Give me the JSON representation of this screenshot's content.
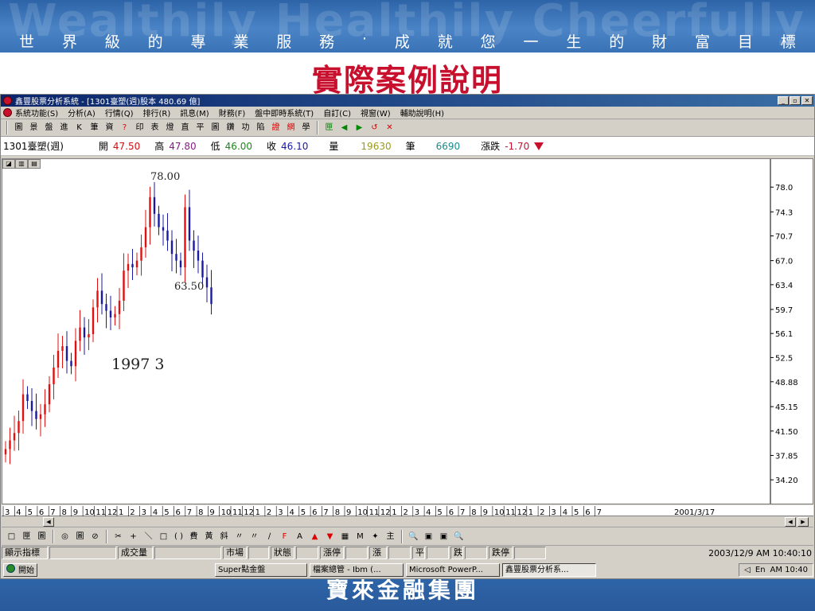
{
  "slide": {
    "watermark": "Wealthily Healthily Cheerfully",
    "slogan": [
      "世",
      "界",
      "級",
      "的",
      "專",
      "業",
      "服",
      "務",
      "·",
      "成",
      "就",
      "您",
      "一",
      "生",
      "的",
      "財",
      "富",
      "目",
      "標"
    ],
    "title": "實際案例說明",
    "footer": "寶來金融集團"
  },
  "window": {
    "title": "鑫豐股票分析系統 - [1301臺塑(週)股本 480.69 億]",
    "controls": [
      "_",
      "▫",
      "✕"
    ],
    "menu": [
      "系統功能(S)",
      "分析(A)",
      "行情(Q)",
      "排行(R)",
      "訊息(M)",
      "財務(F)",
      "盤中即時系統(T)",
      "自訂(C)",
      "視窗(W)",
      "輔助說明(H)"
    ]
  },
  "toolbar": {
    "buttons": [
      "圖",
      "景",
      "盤",
      "進",
      "K",
      "筆",
      "資",
      "?",
      "印",
      "表",
      "燈",
      "直",
      "平",
      "圖",
      "鑽",
      "功",
      "陷",
      "證",
      "網",
      "學"
    ],
    "nav_buttons": [
      "匣",
      "◀",
      "▶",
      "↺",
      "✕"
    ]
  },
  "quote": {
    "symbol": "1301臺塑(週)",
    "open_label": "開",
    "open": "47.50",
    "high_label": "高",
    "high": "47.80",
    "low_label": "低",
    "low": "46.00",
    "close_label": "收",
    "close": "46.10",
    "volume_label": "量",
    "volume": "19630",
    "count_label": "筆",
    "count": "6690",
    "change_label": "漲跌",
    "change": "-1.70",
    "colors": {
      "open": "#d01010",
      "high": "#8a1a8a",
      "low": "#1a8a1a",
      "close": "#1a1aa0",
      "volume": "#9a9a20",
      "count": "#1a8a8a",
      "change": "#c8102e"
    }
  },
  "chart_data": {
    "type": "candlestick",
    "annotations": [
      "78.00",
      "63.50",
      "1997 3"
    ],
    "y_ticks": [
      "78.0",
      "74.3",
      "70.7",
      "67.0",
      "63.4",
      "59.7",
      "56.1",
      "52.5",
      "48.88",
      "45.15",
      "41.50",
      "37.85",
      "34.20"
    ],
    "y_values": [
      78.0,
      74.3,
      70.7,
      67.0,
      63.4,
      59.7,
      56.1,
      52.5,
      48.88,
      45.15,
      41.5,
      37.85,
      34.2
    ],
    "ylim": [
      31.0,
      81.0
    ],
    "x_ticks": [
      "3",
      "4",
      "5",
      "6",
      "7",
      "8",
      "9",
      "10",
      "11",
      "12",
      "1",
      "2",
      "3",
      "4",
      "5",
      "6",
      "7",
      "8",
      "9",
      "10",
      "11",
      "12",
      "1",
      "2",
      "3",
      "4",
      "5",
      "6",
      "7",
      "8",
      "9",
      "10",
      "11",
      "12",
      "1",
      "2",
      "3",
      "4",
      "5",
      "6",
      "7",
      "8",
      "9",
      "10",
      "11",
      "12",
      "1",
      "2",
      "3",
      "4",
      "5",
      "6",
      "7"
    ],
    "date_label": "2001/3/17",
    "colors": {
      "up": "#e01010",
      "down": "#1a1aa0"
    },
    "weekly_close_approx": [
      38.8,
      40.1,
      41.2,
      43.0,
      47.0,
      46.0,
      44.5,
      43.3,
      44.0,
      45.5,
      48.5,
      51.0,
      53.5,
      54.2,
      52.0,
      51.2,
      55.0,
      57.0,
      55.5,
      56.0,
      60.0,
      62.5,
      60.5,
      59.5,
      58.5,
      59.0,
      61.0,
      65.5,
      66.5,
      66.0,
      67.0,
      69.0,
      72.0,
      76.5,
      74.0,
      72.0,
      71.5,
      70.0,
      68.0,
      67.0,
      66.0,
      75.0,
      70.0,
      68.5,
      67.0,
      64.5,
      63.0,
      60.5
    ]
  },
  "drawbar": {
    "buttons": [
      "□",
      "匣",
      "圖",
      "◎",
      "圖",
      "⊘",
      "✂",
      "+",
      "＼",
      "□",
      "( )",
      "費",
      "黃",
      "斜",
      "〃",
      "〃",
      "∕",
      "F",
      "A",
      "▲",
      "▼",
      "▦",
      "M",
      "✦",
      "主",
      "🔍",
      "▣",
      "▣",
      "🔍"
    ]
  },
  "statusbar": {
    "cells": [
      "顯示指標",
      "",
      "成交量",
      "",
      "市場",
      "",
      "狀態",
      "",
      "漲停",
      "",
      "漲",
      "",
      "平",
      "",
      "跌",
      "",
      "跌停",
      ""
    ],
    "datetime": "2003/12/9 AM 10:40:10"
  },
  "taskbar": {
    "start": "開始",
    "tasks": [
      "Super點金盤",
      "檔案總管 - Ibm (...",
      "Microsoft PowerP...",
      "鑫豐股票分析系..."
    ],
    "tray_time": "AM 10:40",
    "tray_lang": "En"
  }
}
